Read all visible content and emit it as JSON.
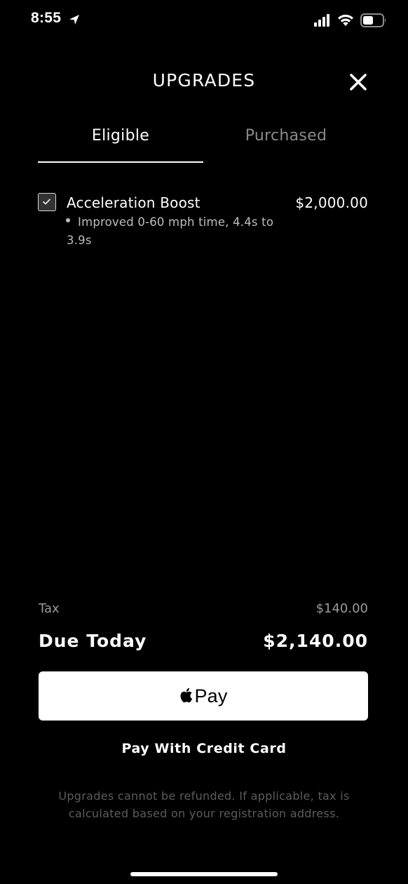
{
  "status_bar": {
    "time": "8:55",
    "icons": [
      "location-arrow-icon",
      "cellular-signal-icon",
      "wifi-icon",
      "battery-icon"
    ]
  },
  "header": {
    "title": "UPGRADES",
    "close_icon": "close-icon"
  },
  "tabs": [
    {
      "label": "Eligible",
      "active": true
    },
    {
      "label": "Purchased",
      "active": false
    }
  ],
  "upgrade_item": {
    "checked": true,
    "name": "Acceleration Boost",
    "price": "$2,000.00",
    "description_line1": "Improved 0-60 mph time, 4.4s to",
    "description_line2": "3.9s"
  },
  "totals": {
    "tax_label": "Tax",
    "tax_value": "$140.00",
    "due_label": "Due Today",
    "due_value": "$2,140.00"
  },
  "payment": {
    "apple_pay_label": "Pay",
    "credit_card_label": "Pay With Credit Card"
  },
  "disclaimer": "Upgrades cannot be refunded. If applicable, tax is calculated based on your registration address.",
  "colors": {
    "background": "#000000",
    "text_primary": "#ffffff",
    "text_secondary": "#8a8a8a",
    "disclaimer": "#5c5c5c"
  }
}
